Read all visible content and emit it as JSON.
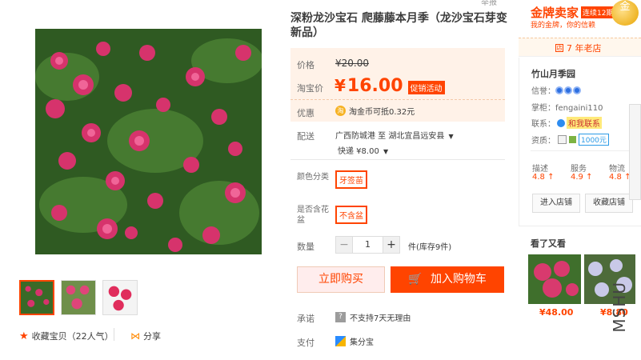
{
  "product": {
    "title": "深粉龙沙宝石 爬藤藤本月季（龙沙宝石芽变新品）",
    "top_cut_text": "举报"
  },
  "price": {
    "list_label": "价格",
    "list_value": "¥20.00",
    "taobao_label": "淘宝价",
    "currency": "¥",
    "current_value": "16.00",
    "promo_label": "促销活动",
    "discount_label": "优惠",
    "discount_text": "淘金币可抵0.32元"
  },
  "shipping": {
    "label": "配送",
    "from_to": "广西防城港 至  湖北宜昌远安县",
    "method": "快递 ¥8.00"
  },
  "sku": {
    "color_label": "颜色分类",
    "color_option": "牙签苗",
    "pot_label": "是否含花盆",
    "pot_option": "不含盆"
  },
  "quantity": {
    "label": "数量",
    "value": "1",
    "minus": "−",
    "plus": "+",
    "stock_text": "件(库存9件)"
  },
  "actions": {
    "buy_now": "立即购买",
    "add_cart": "加入购物车"
  },
  "service": {
    "promise_label": "承诺",
    "promise_text": "不支持7天无理由",
    "pay_label": "支付",
    "pay_text": "集分宝"
  },
  "gallery": {
    "favorite_text": "收藏宝贝（22人气）",
    "share_text": "分享"
  },
  "seller": {
    "gold_title": "金牌卖家",
    "streak_badge": "连续12期",
    "gold_sub": "我的金牌，你的信赖",
    "medal_text": "金",
    "years_text": "7 年老店",
    "shop_name": "竹山月季园",
    "credit_label": "信誉：",
    "owner_label": "掌柜：",
    "owner_value": "fengaini110",
    "contact_label": "联系：",
    "contact_text": "和我联系",
    "qual_label": "资质：",
    "qual_value": "1000元",
    "scores": [
      {
        "label": "描述",
        "value": "4.8 ↑"
      },
      {
        "label": "服务",
        "value": "4.9 ↑"
      },
      {
        "label": "物流",
        "value": "4.8 ↑"
      }
    ],
    "enter_shop": "进入店铺",
    "fav_shop": "收藏店铺"
  },
  "seen_also": {
    "title": "看了又看",
    "items": [
      {
        "price": "¥48.00"
      },
      {
        "price": "¥8.80"
      }
    ]
  },
  "watermark": "MSHU",
  "colors": {
    "accent": "#ff4400",
    "price_panel_bg": "#fff2e8"
  }
}
